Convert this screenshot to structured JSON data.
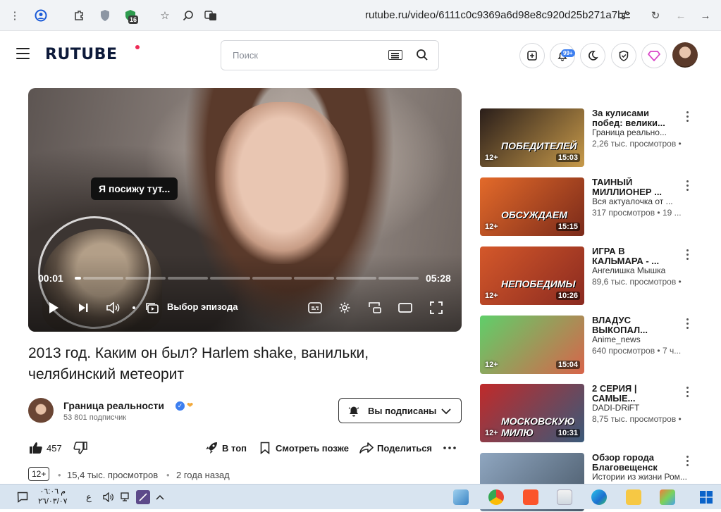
{
  "browser": {
    "url": "rutube.ru/video/6111c0c9369a6d98e8c920d25b271a7b/",
    "extension_badge": "16"
  },
  "header": {
    "logo": "RUTUBE",
    "search_placeholder": "Поиск",
    "notifications_badge": "99+"
  },
  "player": {
    "caption": "Я посижу тут...",
    "current_time": "00:01",
    "duration": "05:28",
    "episode_label": "Выбор эпизода",
    "progress_fraction": 0.003
  },
  "video": {
    "title": "2013 год. Каким он был? Harlem shake, ванильки, челябинский метеорит",
    "channel": "Граница реальности",
    "subscribers": "53 801 подписчик",
    "subscribe_label": "Вы подписаны",
    "likes": "457",
    "boost_label": "В топ",
    "watch_later_label": "Смотреть позже",
    "share_label": "Поделиться",
    "age_rating": "12+",
    "views": "15,4 тыс. просмотров",
    "published": "2 года назад"
  },
  "recommendations": [
    {
      "title_line1": "За кулисами",
      "title_line2": "побед: велики...",
      "channel": "Граница реально...",
      "meta": "2,26 тыс. просмотров  •",
      "age": "12+",
      "duration": "15:03",
      "overlay": "ПОБЕДИТЕЛЕЙ",
      "colors": [
        "#2a1e1a",
        "#c79a4a"
      ]
    },
    {
      "title_line1": "ТАИНЫЙ",
      "title_line2": "МИЛЛИОНЕР ...",
      "channel": "Вся актуалочка от ...",
      "meta": "317 просмотров  •  19 ...",
      "age": "12+",
      "duration": "15:15",
      "overlay": "ОБСУЖДАЕМ",
      "colors": [
        "#e36a2a",
        "#7a2a1a"
      ]
    },
    {
      "title_line1": "ИГРА В",
      "title_line2": "КАЛЬМАРА - ...",
      "channel": "Ангелишка Мышка",
      "meta": "89,6 тыс. просмотров  •",
      "age": "12+",
      "duration": "10:26",
      "overlay": "НЕПОБЕДИМЫ",
      "colors": [
        "#d4582a",
        "#8a2a20"
      ]
    },
    {
      "title_line1": "ВЛАДУС",
      "title_line2": "ВЫКОПАЛ...",
      "channel": "Anime_news",
      "meta": "640 просмотров  •  7 ч...",
      "age": "12+",
      "duration": "15:04",
      "overlay": "",
      "colors": [
        "#5fcf6a",
        "#d8644a"
      ]
    },
    {
      "title_line1": "2 СЕРИЯ |",
      "title_line2": "САМЫЕ...",
      "channel": "DADI-DRiFT",
      "meta": "8,75 тыс. просмотров  •",
      "age": "12+",
      "duration": "10:31",
      "overlay": "МОСКОВСКУЮ МИЛЮ",
      "colors": [
        "#c02a2a",
        "#3a5a7a"
      ]
    },
    {
      "title_line1": "Обзор города",
      "title_line2": "Благовещенск",
      "channel": "Истории из жизни Ром...",
      "meta": "",
      "age": "",
      "duration": "",
      "overlay": "",
      "colors": [
        "#8fa6c0",
        "#4a5a6a"
      ]
    }
  ],
  "taskbar": {
    "time": "م ٠٦:٠٦",
    "date": "٢٦/٠٣/٠٧",
    "lang": "ع"
  },
  "colors": {
    "accent": "#ee2a56",
    "verified": "#3d7ff0"
  }
}
